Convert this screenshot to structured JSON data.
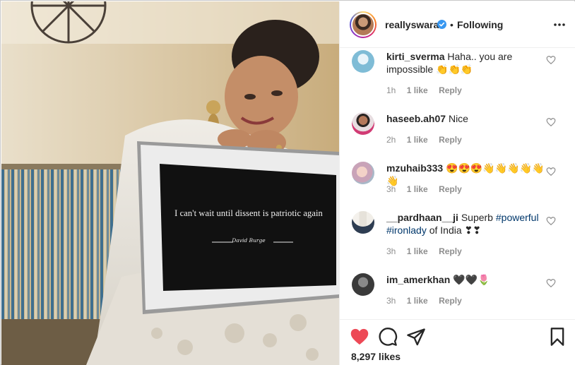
{
  "post": {
    "board_caption": "I can't wait until dissent is patriotic again",
    "board_signature": "David Burge"
  },
  "header": {
    "username": "reallyswara",
    "verified": true,
    "separator": "•",
    "follow_status": "Following",
    "more_icon": "more-horizontal-icon"
  },
  "comments": [
    {
      "user": "kirti_sverma",
      "text": "Haha.. you are impossible 👏👏👏",
      "time": "1h",
      "likes": "1 like",
      "reply": "Reply"
    },
    {
      "user": "haseeb.ah07",
      "text": "Nice",
      "time": "2h",
      "likes": "1 like",
      "reply": "Reply"
    },
    {
      "user": "mzuhaib333",
      "text": "😍😍😍👋👋👋👋👋👋",
      "time": "3h",
      "likes": "1 like",
      "reply": "Reply"
    },
    {
      "user": "__pardhaan__ji",
      "text_before": "Superb",
      "tag1": "#powerful",
      "tag2": "#ironlady",
      "text_after": "of India ❣❣",
      "time": "3h",
      "likes": "1 like",
      "reply": "Reply"
    },
    {
      "user": "im_amerkhan",
      "text": "🖤🖤🌷",
      "time": "3h",
      "likes": "1 like",
      "reply": "Reply"
    }
  ],
  "actions": {
    "like_icon": "heart-filled-icon",
    "comment_icon": "comment-icon",
    "share_icon": "share-icon",
    "save_icon": "bookmark-icon",
    "like_color": "#ed4956"
  },
  "likes_count": "8,297 likes"
}
